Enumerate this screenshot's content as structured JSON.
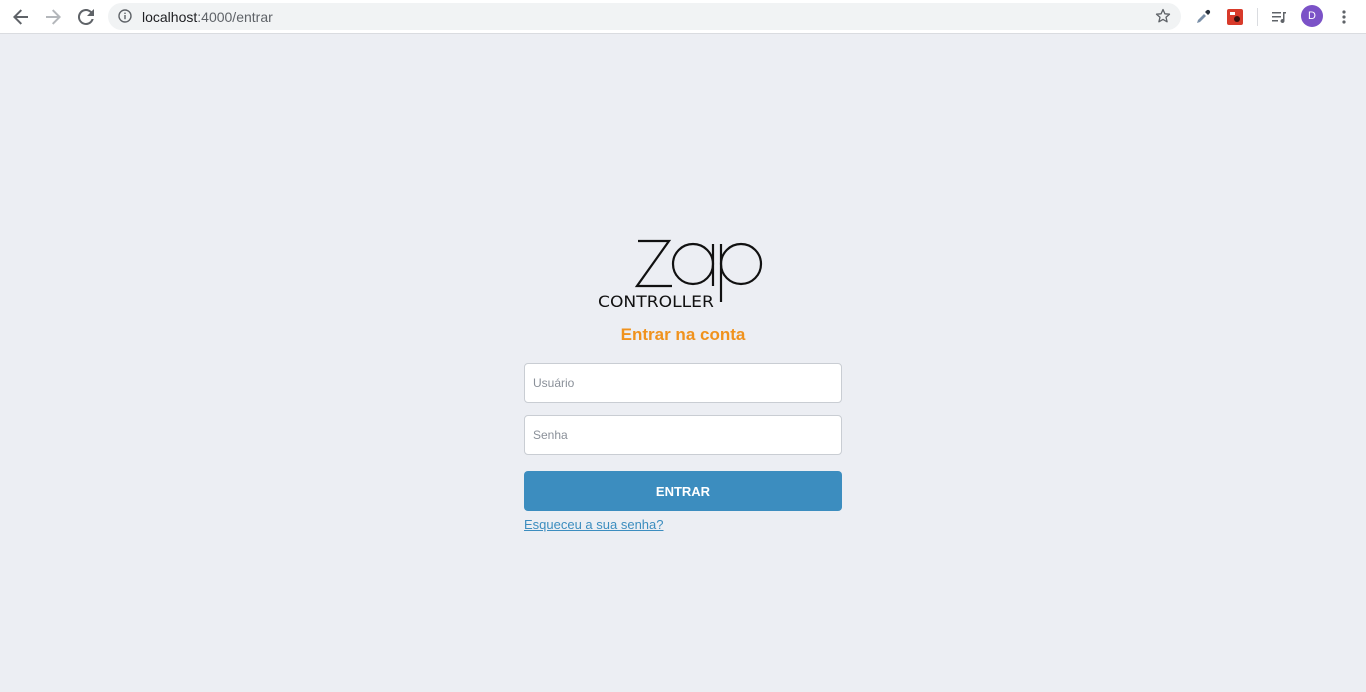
{
  "browser": {
    "url_host": "localhost",
    "url_path": ":4000/entrar",
    "profile_initial": "D"
  },
  "logo": {
    "word": "zap",
    "subtitle": "CONTROLLER"
  },
  "login": {
    "heading": "Entrar na conta",
    "username_placeholder": "Usuário",
    "password_placeholder": "Senha",
    "submit_label": "ENTRAR",
    "forgot_link": "Esqueceu a sua senha?"
  },
  "colors": {
    "background": "#eceef3",
    "accent_orange": "#f0921d",
    "primary_blue": "#3c8dbf",
    "avatar_purple": "#7b52c7"
  }
}
